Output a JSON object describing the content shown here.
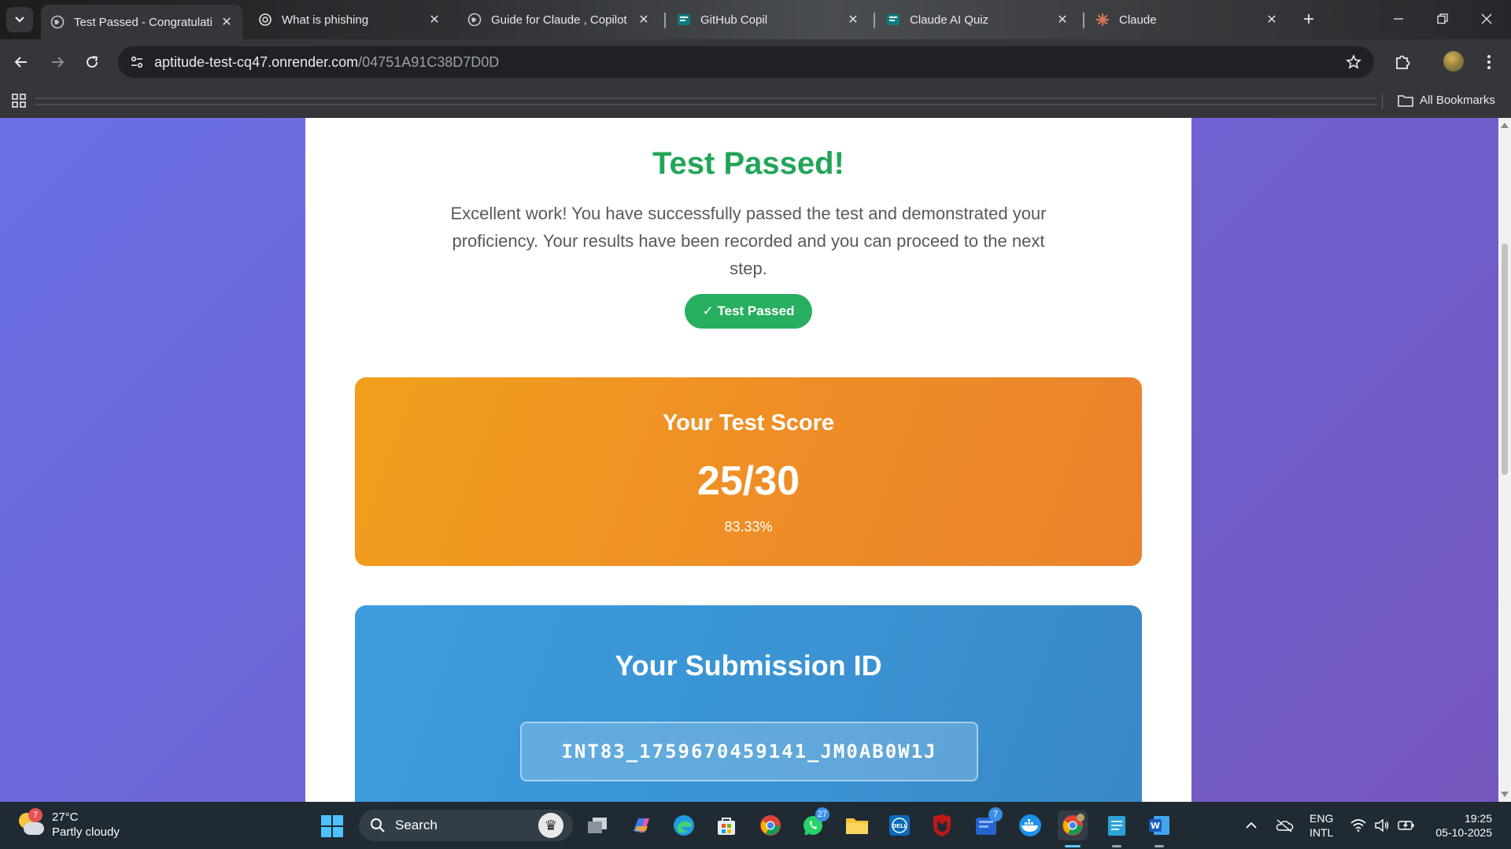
{
  "browser": {
    "tabs": [
      {
        "title": "Test Passed - Congratulatio",
        "icon": "globe-icon",
        "active": true
      },
      {
        "title": "What is phishing",
        "icon": "openai-icon",
        "active": false
      },
      {
        "title": "Guide for Claude , Copilot",
        "icon": "globe-icon",
        "active": false
      },
      {
        "title": "GitHub Copil",
        "icon": "forms-icon",
        "active": false
      },
      {
        "title": "Claude AI Quiz",
        "icon": "forms-icon",
        "active": false
      },
      {
        "title": "Claude",
        "icon": "claude-icon",
        "active": false
      }
    ],
    "address": {
      "domain": "aptitude-test-cq47.onrender.com",
      "path": "/04751A91C38D7D0D"
    },
    "bookmarks_label": "All Bookmarks"
  },
  "page": {
    "heading": "Test Passed!",
    "message": "Excellent work! You have successfully passed the test and demonstrated your proficiency. Your results have been recorded and you can proceed to the next step.",
    "badge": "✓ Test Passed",
    "score_label": "Your Test Score",
    "score": "25/30",
    "percentage": "83.33%",
    "submission_label": "Your Submission ID",
    "submission_id": "INT83_1759670459141_JM0AB0W1J",
    "colors": {
      "success": "#27ae60",
      "score_bg": "#f0952a",
      "submission_bg": "#3a92d2",
      "page_bg": "#6f62d2"
    }
  },
  "taskbar": {
    "weather": {
      "temp": "27°C",
      "condition": "Partly cloudy",
      "badge": "7"
    },
    "search_placeholder": "Search",
    "apps": [
      {
        "name": "task-view",
        "badge": ""
      },
      {
        "name": "copilot",
        "badge": ""
      },
      {
        "name": "edge",
        "badge": ""
      },
      {
        "name": "microsoft-store",
        "badge": ""
      },
      {
        "name": "chrome",
        "badge": ""
      },
      {
        "name": "whatsapp",
        "badge": "27"
      },
      {
        "name": "file-explorer",
        "badge": ""
      },
      {
        "name": "dell",
        "badge": ""
      },
      {
        "name": "mcafee",
        "badge": ""
      },
      {
        "name": "todo",
        "badge": "7"
      },
      {
        "name": "docker",
        "badge": ""
      },
      {
        "name": "chrome-active",
        "badge": ""
      },
      {
        "name": "notepad",
        "badge": ""
      },
      {
        "name": "word",
        "badge": ""
      }
    ],
    "language": {
      "line1": "ENG",
      "line2": "INTL"
    },
    "time": "19:25",
    "date": "05-10-2025"
  }
}
